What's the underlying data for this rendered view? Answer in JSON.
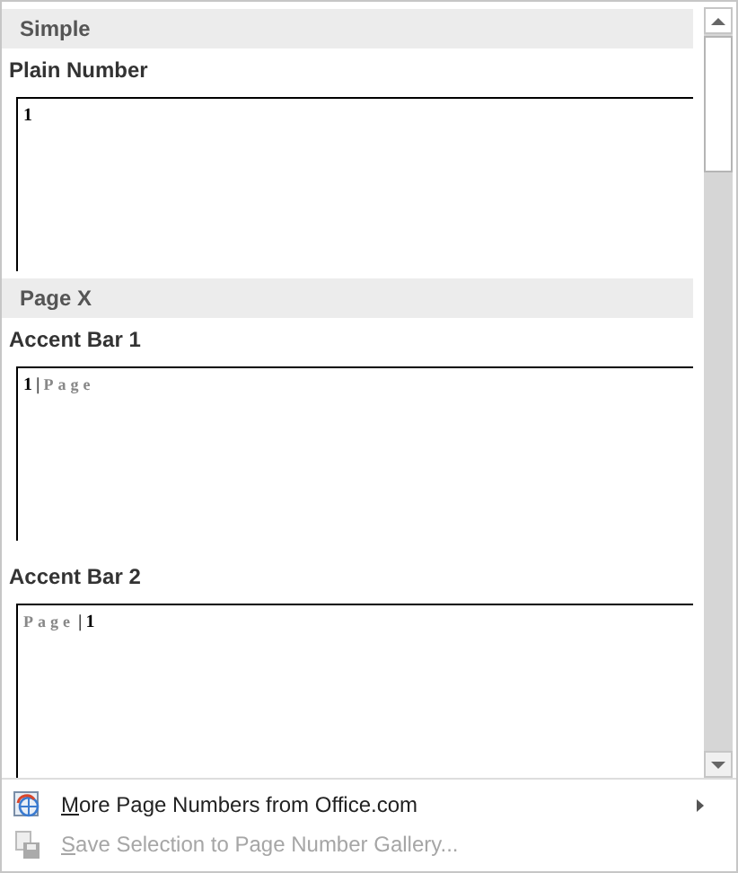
{
  "gallery": {
    "sections": [
      {
        "heading": "Simple",
        "items": [
          {
            "label": "Plain Number",
            "preview": [
              {
                "kind": "number",
                "text": "1"
              }
            ]
          }
        ]
      },
      {
        "heading": "Page X",
        "items": [
          {
            "label": "Accent Bar 1",
            "preview": [
              {
                "kind": "number",
                "text": "1"
              },
              {
                "kind": "bar",
                "text": "|"
              },
              {
                "kind": "word",
                "text": "Page"
              }
            ]
          },
          {
            "label": "Accent Bar 2",
            "preview": [
              {
                "kind": "word",
                "text": "Page"
              },
              {
                "kind": "bar",
                "text": "|"
              },
              {
                "kind": "number",
                "text": "1"
              }
            ]
          }
        ]
      }
    ]
  },
  "menu": [
    {
      "kind": "globe",
      "label": "More Page Numbers from Office.com",
      "disabled": false,
      "submenu": true
    },
    {
      "kind": "save",
      "label": "Save Selection to Page Number Gallery...",
      "disabled": true,
      "submenu": false
    }
  ]
}
